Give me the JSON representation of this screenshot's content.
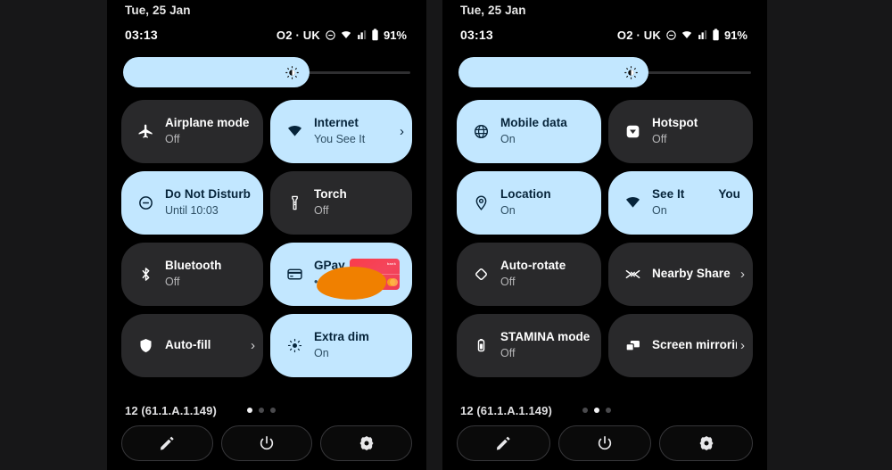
{
  "theme": {
    "background": "#171718",
    "panel_bg": "#000000",
    "tile_off": "#29292b",
    "tile_on": "#c2e7ff",
    "accent_text_on": "#06243a",
    "redaction_color": "#f08000",
    "card_color": "#fa3c4a"
  },
  "panels": [
    {
      "id": "page-1",
      "date": "Tue, 25 Jan",
      "status": {
        "clock": "03:13",
        "carrier": "O2 · UK",
        "icons": [
          "dnd-icon",
          "wifi-icon",
          "signal-icon",
          "battery-icon"
        ],
        "battery": "91%"
      },
      "brightness": {
        "label": "Brightness",
        "level": 65,
        "icon": "brightness-icon"
      },
      "tiles": [
        {
          "name": "airplane-mode",
          "icon": "airplane-icon",
          "label": "Airplane mode",
          "sub": "Off",
          "state": "off",
          "chevron": false
        },
        {
          "name": "internet",
          "icon": "wifi-icon",
          "label": "Internet",
          "sub": "You See It",
          "state": "on",
          "chevron": true
        },
        {
          "name": "do-not-disturb",
          "icon": "dnd-icon",
          "label": "Do Not Disturb",
          "sub": "Until 10:03",
          "state": "on",
          "chevron": false
        },
        {
          "name": "torch",
          "icon": "torch-icon",
          "label": "Torch",
          "sub": "Off",
          "state": "off",
          "chevron": false
        },
        {
          "name": "bluetooth",
          "icon": "bluetooth-icon",
          "label": "Bluetooth",
          "sub": "Off",
          "state": "off",
          "chevron": false
        },
        {
          "name": "gpay",
          "icon": "card-icon",
          "label": "GPay",
          "sub": "••",
          "state": "on",
          "chevron": false,
          "redacted": true,
          "card_art": true
        },
        {
          "name": "auto-fill",
          "icon": "shield-icon",
          "label": "Auto-fill",
          "sub": "",
          "state": "off",
          "chevron": true
        },
        {
          "name": "extra-dim",
          "icon": "extra-dim-icon",
          "label": "Extra dim",
          "sub": "On",
          "state": "on",
          "chevron": false
        }
      ],
      "footer": {
        "build": "12 (61.1.A.1.149)",
        "dots": 3,
        "active_dot": 0,
        "actions": [
          {
            "name": "edit-tiles-button",
            "icon": "pencil-icon"
          },
          {
            "name": "power-button",
            "icon": "power-icon"
          },
          {
            "name": "settings-button",
            "icon": "gear-icon"
          }
        ]
      }
    },
    {
      "id": "page-2",
      "date": "Tue, 25 Jan",
      "status": {
        "clock": "03:13",
        "carrier": "O2 · UK",
        "icons": [
          "dnd-icon",
          "wifi-icon",
          "signal-icon",
          "battery-icon"
        ],
        "battery": "91%"
      },
      "brightness": {
        "label": "Brightness",
        "level": 65,
        "icon": "brightness-icon"
      },
      "tiles": [
        {
          "name": "mobile-data",
          "icon": "globe-icon",
          "label": "Mobile data",
          "sub": "On",
          "state": "on",
          "chevron": false
        },
        {
          "name": "hotspot",
          "icon": "hotspot-icon",
          "label": "Hotspot",
          "sub": "Off",
          "state": "off",
          "chevron": false
        },
        {
          "name": "location",
          "icon": "location-icon",
          "label": "Location",
          "sub": "On",
          "state": "on",
          "chevron": false
        },
        {
          "name": "wifi",
          "icon": "wifi-icon",
          "label": "See It",
          "label2": "You",
          "sub": "On",
          "state": "on",
          "chevron": false,
          "marquee": true
        },
        {
          "name": "auto-rotate",
          "icon": "auto-rotate-icon",
          "label": "Auto-rotate",
          "sub": "Off",
          "state": "off",
          "chevron": false
        },
        {
          "name": "nearby-share",
          "icon": "nearby-share-icon",
          "label": "Nearby Share",
          "sub": "",
          "state": "off",
          "chevron": true
        },
        {
          "name": "stamina-mode",
          "icon": "battery-icon",
          "label": "STAMINA mode",
          "sub": "Off",
          "state": "off",
          "chevron": false
        },
        {
          "name": "screen-mirroring",
          "icon": "screen-cast-icon",
          "label": "Screen mirroring",
          "sub": "",
          "state": "off",
          "chevron": true
        }
      ],
      "footer": {
        "build": "12 (61.1.A.1.149)",
        "dots": 3,
        "active_dot": 1,
        "actions": [
          {
            "name": "edit-tiles-button",
            "icon": "pencil-icon"
          },
          {
            "name": "power-button",
            "icon": "power-icon"
          },
          {
            "name": "settings-button",
            "icon": "gear-icon"
          }
        ]
      }
    }
  ]
}
